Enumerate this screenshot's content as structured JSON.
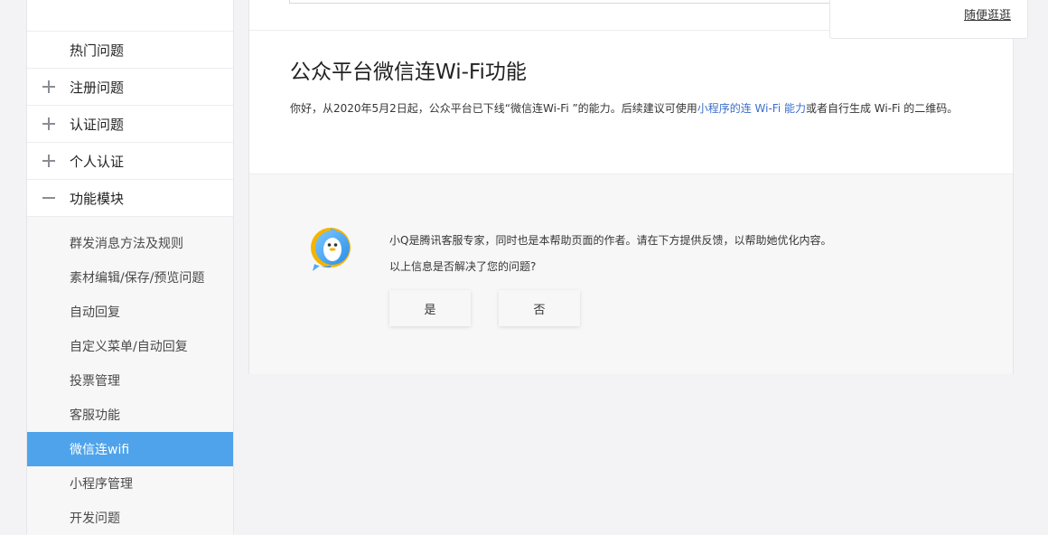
{
  "sidebar": {
    "items": [
      {
        "label": "热门问题",
        "sign": "none"
      },
      {
        "label": "注册问题",
        "sign": "plus"
      },
      {
        "label": "认证问题",
        "sign": "plus"
      },
      {
        "label": "个人认证",
        "sign": "plus"
      },
      {
        "label": "功能模块",
        "sign": "minus"
      }
    ],
    "subitems": [
      {
        "label": "群发消息方法及规则"
      },
      {
        "label": "素材编辑/保存/预览问题"
      },
      {
        "label": "自动回复"
      },
      {
        "label": "自定义菜单/自动回复"
      },
      {
        "label": "投票管理"
      },
      {
        "label": "客服功能"
      },
      {
        "label": "微信连wifi",
        "active": true
      },
      {
        "label": "小程序管理"
      },
      {
        "label": "开发问题"
      }
    ]
  },
  "article": {
    "title": "公众平台微信连Wi-Fi功能",
    "intro_prefix": "你好，从2020年5月2日起，公众平台已下线“微信连Wi-Fi ”的能力。后续建议可使用",
    "intro_link": "小程序的连 Wi-Fi 能力",
    "intro_suffix": "或者自行生成 Wi-Fi 的二维码。"
  },
  "feedback": {
    "author_text": "小Q是腾讯客服专家，同时也是本帮助页面的作者。请在下方提供反馈，以帮助她优化内容。",
    "question": "以上信息是否解决了您的问题?",
    "yes_label": "是",
    "no_label": "否",
    "avatar_icon": "qq-penguin-icon"
  },
  "popup": {
    "link": "随便逛逛"
  },
  "colors": {
    "accent": "#4fa3ea",
    "link": "#3b6fc9"
  }
}
